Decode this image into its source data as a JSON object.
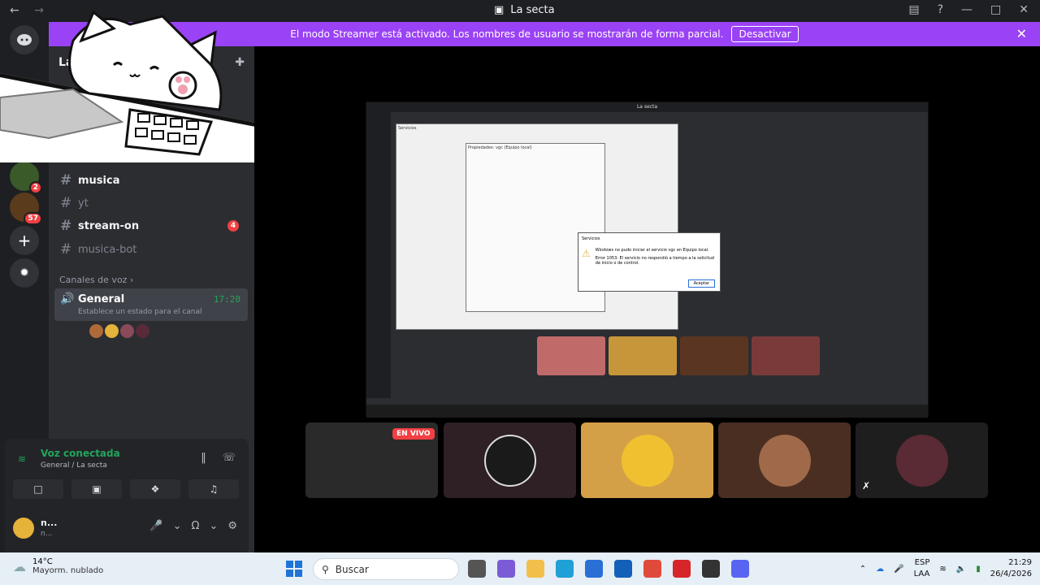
{
  "window": {
    "title": "La secta",
    "back_icon": "←",
    "forward_icon": "→"
  },
  "streamer": {
    "message": "El modo Streamer está activado. Los nombres de usuario se mostrarán de forma parcial.",
    "deactivate_label": "Desactivar"
  },
  "server": {
    "name": "La",
    "rail_badges": [
      "2",
      "57"
    ]
  },
  "channels": {
    "text": [
      {
        "name": "musica",
        "state": "unread"
      },
      {
        "name": "yt",
        "state": "muted"
      },
      {
        "name": "stream-on",
        "state": "unread",
        "badge": "4"
      },
      {
        "name": "musica-bot",
        "state": "muted"
      }
    ],
    "voice_category": "Canales de voz",
    "voice_channel": {
      "name": "General",
      "time": "17:20",
      "status_placeholder": "Establece un estado para el canal"
    }
  },
  "voice_panel": {
    "title": "Voz conectada",
    "subtitle": "General / La secta"
  },
  "user": {
    "name": "n...",
    "status": "n..."
  },
  "stage": {
    "live_label": "EN VIVO",
    "inner_title": "La secta",
    "dialog_title": "Servicios",
    "dialog_text": "Windows no pudo iniciar el servicio vgc en Equipo local.",
    "dialog_error": "Error 1053: El servicio no respondió a tiempo a la solicitud de inicio o de control.",
    "dialog_button": "Aceptar",
    "props_title": "Propiedades: vgc (Equipo local)",
    "services_title": "Servicios"
  },
  "taskbar": {
    "temperature": "14°C",
    "weather": "Mayorm. nublado",
    "search_placeholder": "Buscar",
    "lang_1": "ESP",
    "lang_2": "LAA",
    "time": "21:29",
    "date": "26/4/2026"
  },
  "colors": {
    "streamer_banner": "#9a42f5",
    "voice_green": "#23a55a",
    "badge_red": "#f23f43",
    "blurple": "#5865f2"
  }
}
